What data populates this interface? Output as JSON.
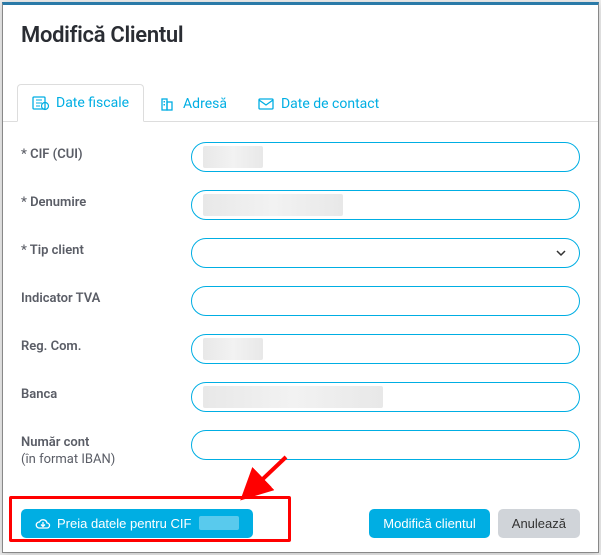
{
  "modal": {
    "title": "Modifică Clientul"
  },
  "tabs": {
    "fiscal": "Date fiscale",
    "adresa": "Adresă",
    "contact": "Date de contact"
  },
  "fields": {
    "cif": {
      "label": "* CIF (CUI)",
      "value": ""
    },
    "denumire": {
      "label": "* Denumire",
      "value": ""
    },
    "tip_client": {
      "label": "* Tip client",
      "value": ""
    },
    "indicator_tva": {
      "label": "Indicator TVA",
      "value": ""
    },
    "reg_com": {
      "label": "Reg. Com.",
      "value": ""
    },
    "banca": {
      "label": "Banca",
      "value": ""
    },
    "numar_cont": {
      "label": "Număr cont",
      "sublabel": "(în format IBAN)",
      "value": ""
    }
  },
  "footer": {
    "fetch_label": "Preia datele pentru CIF",
    "save_label": "Modifică clientul",
    "cancel_label": "Anulează"
  }
}
